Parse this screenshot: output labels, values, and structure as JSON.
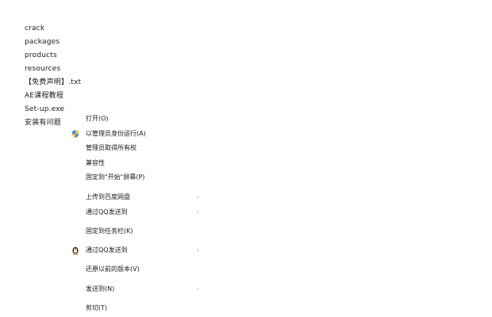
{
  "file_list": {
    "items": [
      {
        "name": "crack"
      },
      {
        "name": "packages"
      },
      {
        "name": "products"
      },
      {
        "name": "resources"
      },
      {
        "name": "【免费声明】.txt"
      },
      {
        "name": "AE课程教程"
      },
      {
        "name": "Set-up.exe"
      },
      {
        "name": "安装有问题"
      }
    ]
  },
  "context_menu": {
    "items": [
      {
        "label": "打开(O)"
      },
      {
        "label": "以管理员身份运行(A)",
        "icon": "shield-icon"
      },
      {
        "label": "管理员取得所有权"
      },
      {
        "label": "兼容性"
      },
      {
        "label": "固定到\"开始\"屏幕(P)"
      },
      {
        "label": "上传到百度网盘",
        "submenu": true
      },
      {
        "label": "通过QQ发送到",
        "submenu": true
      },
      {
        "label": "固定到任务栏(K)"
      },
      {
        "label": "通过QQ发送到",
        "submenu": true,
        "icon": "qq-penguin-icon"
      },
      {
        "label": "还原以前的版本(V)"
      },
      {
        "label": "发送到(N)",
        "submenu": true
      },
      {
        "label": "剪切(T)"
      }
    ],
    "submenu_arrow": "›"
  }
}
